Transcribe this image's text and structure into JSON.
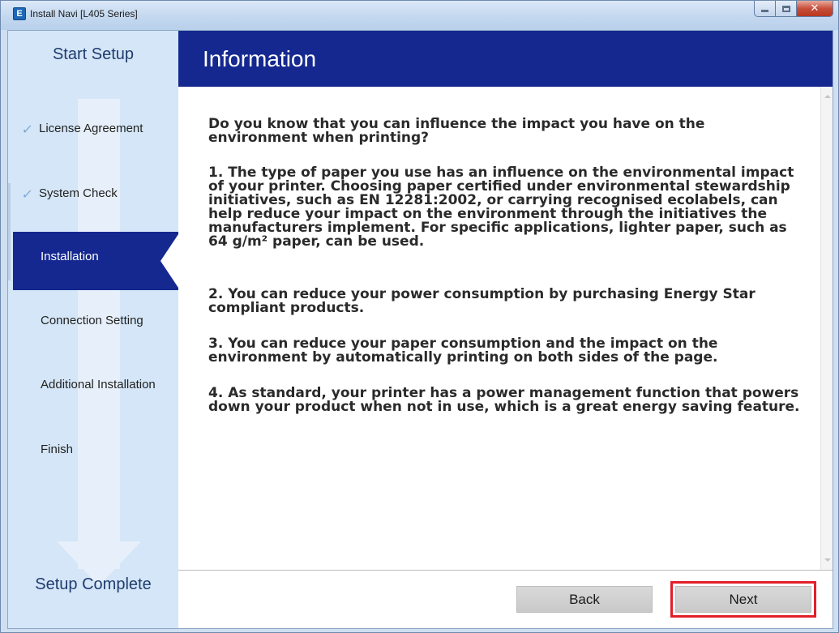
{
  "window": {
    "title": "Install Navi [L405 Series]",
    "app_icon_letter": "E"
  },
  "sidebar": {
    "start_label": "Start Setup",
    "end_label": "Setup Complete",
    "steps": [
      {
        "label": "License Agreement",
        "status": "done"
      },
      {
        "label": "System Check",
        "status": "done"
      },
      {
        "label": "Installation",
        "status": "active"
      },
      {
        "label": "Connection Setting",
        "status": "pending"
      },
      {
        "label": "Additional Installation",
        "status": "pending"
      },
      {
        "label": "Finish",
        "status": "pending"
      }
    ],
    "check_glyph": "✓"
  },
  "header": {
    "title": "Information"
  },
  "content": {
    "paragraphs": [
      "Do you know that you can influence the impact you have on the environment when printing?",
      "1. The type of paper you use has an influence on the environmental impact of your printer. Choosing paper certified under environmental stewardship initiatives, such as EN 12281:2002, or carrying recognised ecolabels, can help reduce your impact on the environment through the initiatives the manufacturers implement. For specific applications, lighter paper, such as 64 g/m² paper, can be used.",
      "2. You can reduce your power consumption by purchasing Energy Star compliant products.",
      "3. You can reduce your paper consumption and the impact on the environment by automatically printing on both sides of the page.",
      "4. As standard, your printer has a power management function that powers down your product when not in use, which is a great energy saving feature."
    ]
  },
  "footer": {
    "back_label": "Back",
    "next_label": "Next"
  },
  "colors": {
    "accent_navy": "#14288f",
    "sidebar_bg": "#d4e6f7",
    "highlight_red": "#e21e2a"
  }
}
